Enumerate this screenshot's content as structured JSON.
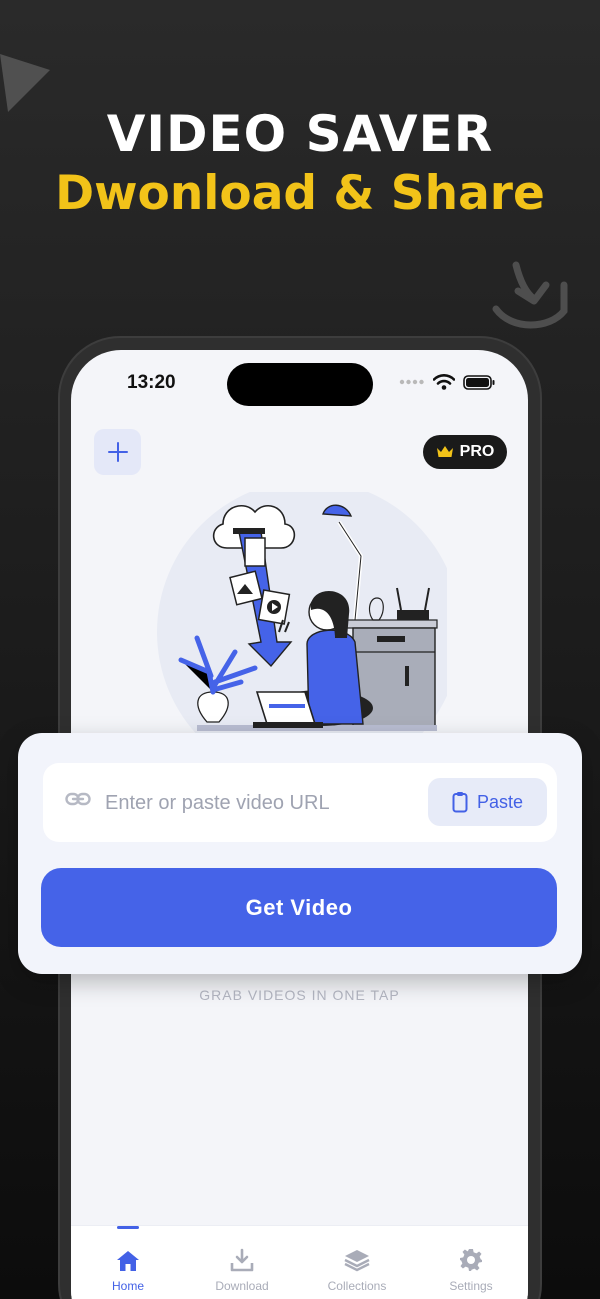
{
  "promo": {
    "title": "VIDEO SAVER",
    "subtitle": "Dwonload & Share"
  },
  "status_bar": {
    "time": "13:20",
    "icons": [
      "signal-icon",
      "wifi-icon",
      "battery-icon"
    ]
  },
  "header": {
    "add_icon": "plus-icon",
    "pro_label": "PRO",
    "pro_icon": "crown-icon"
  },
  "url_card": {
    "placeholder": "Enter or paste video URL",
    "paste_label": "Paste",
    "get_video_label": "Get Video"
  },
  "tagline": "GRAB VIDEOS IN ONE TAP",
  "tab_bar": {
    "tabs": [
      {
        "label": "Home",
        "icon": "home-icon",
        "active": true
      },
      {
        "label": "Download",
        "icon": "download-icon",
        "active": false
      },
      {
        "label": "Collections",
        "icon": "layers-icon",
        "active": false
      },
      {
        "label": "Settings",
        "icon": "gear-icon",
        "active": false
      }
    ]
  },
  "colors": {
    "accent": "#4563e8",
    "promo_yellow": "#f2c319",
    "background_dark": "#1d1d1d",
    "screen_bg": "#f4f5f9"
  }
}
